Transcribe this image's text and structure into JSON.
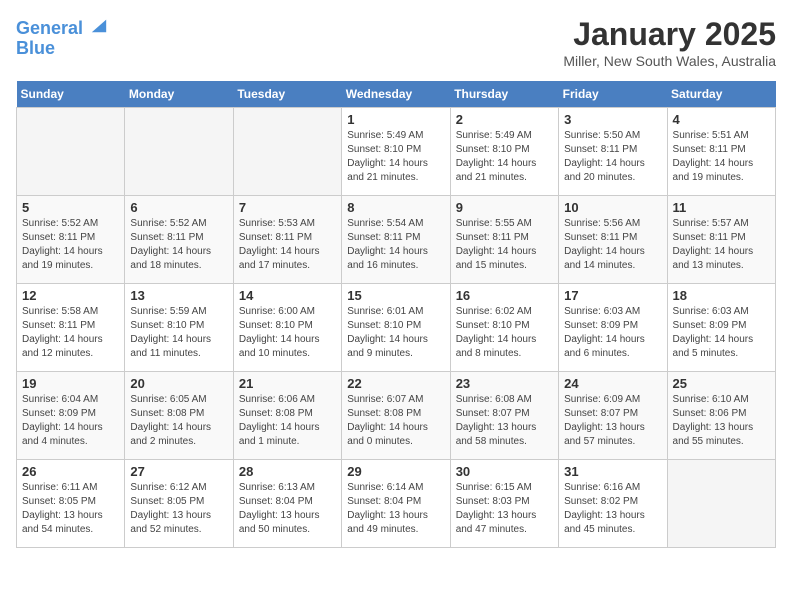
{
  "header": {
    "logo_line1": "General",
    "logo_line2": "Blue",
    "title": "January 2025",
    "subtitle": "Miller, New South Wales, Australia"
  },
  "days_of_week": [
    "Sunday",
    "Monday",
    "Tuesday",
    "Wednesday",
    "Thursday",
    "Friday",
    "Saturday"
  ],
  "weeks": [
    [
      {
        "day": "",
        "info": ""
      },
      {
        "day": "",
        "info": ""
      },
      {
        "day": "",
        "info": ""
      },
      {
        "day": "1",
        "info": "Sunrise: 5:49 AM\nSunset: 8:10 PM\nDaylight: 14 hours\nand 21 minutes."
      },
      {
        "day": "2",
        "info": "Sunrise: 5:49 AM\nSunset: 8:10 PM\nDaylight: 14 hours\nand 21 minutes."
      },
      {
        "day": "3",
        "info": "Sunrise: 5:50 AM\nSunset: 8:11 PM\nDaylight: 14 hours\nand 20 minutes."
      },
      {
        "day": "4",
        "info": "Sunrise: 5:51 AM\nSunset: 8:11 PM\nDaylight: 14 hours\nand 19 minutes."
      }
    ],
    [
      {
        "day": "5",
        "info": "Sunrise: 5:52 AM\nSunset: 8:11 PM\nDaylight: 14 hours\nand 19 minutes."
      },
      {
        "day": "6",
        "info": "Sunrise: 5:52 AM\nSunset: 8:11 PM\nDaylight: 14 hours\nand 18 minutes."
      },
      {
        "day": "7",
        "info": "Sunrise: 5:53 AM\nSunset: 8:11 PM\nDaylight: 14 hours\nand 17 minutes."
      },
      {
        "day": "8",
        "info": "Sunrise: 5:54 AM\nSunset: 8:11 PM\nDaylight: 14 hours\nand 16 minutes."
      },
      {
        "day": "9",
        "info": "Sunrise: 5:55 AM\nSunset: 8:11 PM\nDaylight: 14 hours\nand 15 minutes."
      },
      {
        "day": "10",
        "info": "Sunrise: 5:56 AM\nSunset: 8:11 PM\nDaylight: 14 hours\nand 14 minutes."
      },
      {
        "day": "11",
        "info": "Sunrise: 5:57 AM\nSunset: 8:11 PM\nDaylight: 14 hours\nand 13 minutes."
      }
    ],
    [
      {
        "day": "12",
        "info": "Sunrise: 5:58 AM\nSunset: 8:11 PM\nDaylight: 14 hours\nand 12 minutes."
      },
      {
        "day": "13",
        "info": "Sunrise: 5:59 AM\nSunset: 8:10 PM\nDaylight: 14 hours\nand 11 minutes."
      },
      {
        "day": "14",
        "info": "Sunrise: 6:00 AM\nSunset: 8:10 PM\nDaylight: 14 hours\nand 10 minutes."
      },
      {
        "day": "15",
        "info": "Sunrise: 6:01 AM\nSunset: 8:10 PM\nDaylight: 14 hours\nand 9 minutes."
      },
      {
        "day": "16",
        "info": "Sunrise: 6:02 AM\nSunset: 8:10 PM\nDaylight: 14 hours\nand 8 minutes."
      },
      {
        "day": "17",
        "info": "Sunrise: 6:03 AM\nSunset: 8:09 PM\nDaylight: 14 hours\nand 6 minutes."
      },
      {
        "day": "18",
        "info": "Sunrise: 6:03 AM\nSunset: 8:09 PM\nDaylight: 14 hours\nand 5 minutes."
      }
    ],
    [
      {
        "day": "19",
        "info": "Sunrise: 6:04 AM\nSunset: 8:09 PM\nDaylight: 14 hours\nand 4 minutes."
      },
      {
        "day": "20",
        "info": "Sunrise: 6:05 AM\nSunset: 8:08 PM\nDaylight: 14 hours\nand 2 minutes."
      },
      {
        "day": "21",
        "info": "Sunrise: 6:06 AM\nSunset: 8:08 PM\nDaylight: 14 hours\nand 1 minute."
      },
      {
        "day": "22",
        "info": "Sunrise: 6:07 AM\nSunset: 8:08 PM\nDaylight: 14 hours\nand 0 minutes."
      },
      {
        "day": "23",
        "info": "Sunrise: 6:08 AM\nSunset: 8:07 PM\nDaylight: 13 hours\nand 58 minutes."
      },
      {
        "day": "24",
        "info": "Sunrise: 6:09 AM\nSunset: 8:07 PM\nDaylight: 13 hours\nand 57 minutes."
      },
      {
        "day": "25",
        "info": "Sunrise: 6:10 AM\nSunset: 8:06 PM\nDaylight: 13 hours\nand 55 minutes."
      }
    ],
    [
      {
        "day": "26",
        "info": "Sunrise: 6:11 AM\nSunset: 8:05 PM\nDaylight: 13 hours\nand 54 minutes."
      },
      {
        "day": "27",
        "info": "Sunrise: 6:12 AM\nSunset: 8:05 PM\nDaylight: 13 hours\nand 52 minutes."
      },
      {
        "day": "28",
        "info": "Sunrise: 6:13 AM\nSunset: 8:04 PM\nDaylight: 13 hours\nand 50 minutes."
      },
      {
        "day": "29",
        "info": "Sunrise: 6:14 AM\nSunset: 8:04 PM\nDaylight: 13 hours\nand 49 minutes."
      },
      {
        "day": "30",
        "info": "Sunrise: 6:15 AM\nSunset: 8:03 PM\nDaylight: 13 hours\nand 47 minutes."
      },
      {
        "day": "31",
        "info": "Sunrise: 6:16 AM\nSunset: 8:02 PM\nDaylight: 13 hours\nand 45 minutes."
      },
      {
        "day": "",
        "info": ""
      }
    ]
  ]
}
